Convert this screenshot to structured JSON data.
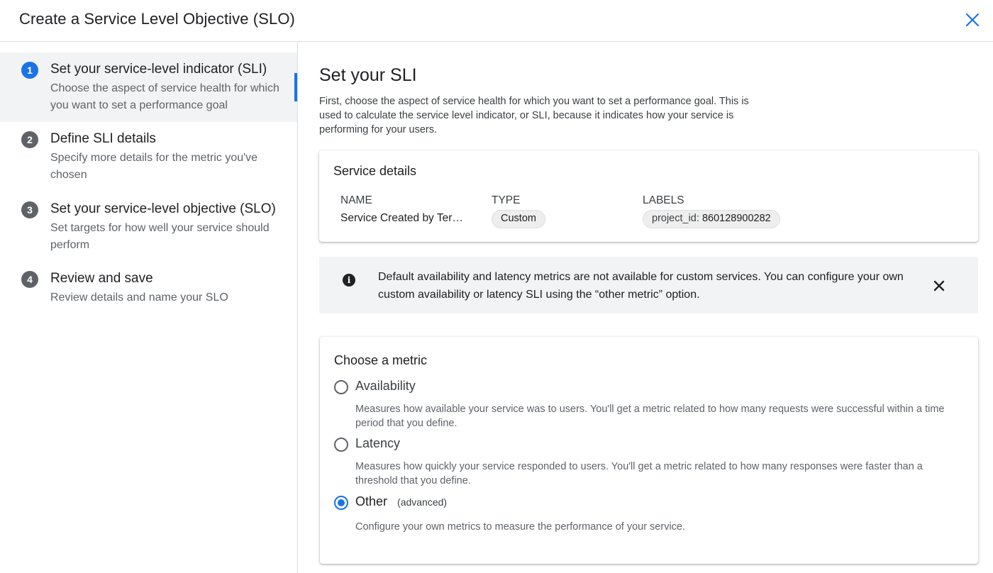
{
  "header": {
    "title": "Create a Service Level Objective (SLO)"
  },
  "stepper": {
    "steps": [
      {
        "number": "1",
        "title": "Set your service-level indicator (SLI)",
        "description": "Choose the aspect of service health for which you want to set a performance goal"
      },
      {
        "number": "2",
        "title": "Define SLI details",
        "description": "Specify more details for the metric you've chosen"
      },
      {
        "number": "3",
        "title": "Set your service-level objective (SLO)",
        "description": "Set targets for how well your service should perform"
      },
      {
        "number": "4",
        "title": "Review and save",
        "description": "Review details and name your SLO"
      }
    ]
  },
  "main": {
    "heading": "Set your SLI",
    "intro": "First, choose the aspect of service health for which you want to set a performance goal. This is used to calculate the service level indicator, or SLI, because it indicates how your service is performing for your users.",
    "service_details": {
      "title": "Service details",
      "name_header": "NAME",
      "type_header": "TYPE",
      "labels_header": "LABELS",
      "name_value": "Service Created by Ter…",
      "type_value": "Custom",
      "label_key": "project_id:",
      "label_value": "860128900282"
    },
    "banner": {
      "text": "Default availability and latency metrics are not available for custom services. You can configure your own custom availability or latency SLI using the “other metric” option."
    },
    "metric": {
      "title": "Choose a metric",
      "options": [
        {
          "label": "Availability",
          "sublabel": "",
          "description": "Measures how available your service was to users. You'll get a metric related to how many requests were successful within a time period that you define."
        },
        {
          "label": "Latency",
          "sublabel": "",
          "description": "Measures how quickly your service responded to users. You'll get a metric related to how many responses were faster than a threshold that you define."
        },
        {
          "label": "Other",
          "sublabel": "(advanced)",
          "description": "Configure your own metrics to measure the performance of your service."
        }
      ],
      "selected": "Other"
    }
  },
  "colors": {
    "accent": "#1a73e8",
    "step_inactive": "#5f6368",
    "active_bg": "#f1f3f4"
  }
}
